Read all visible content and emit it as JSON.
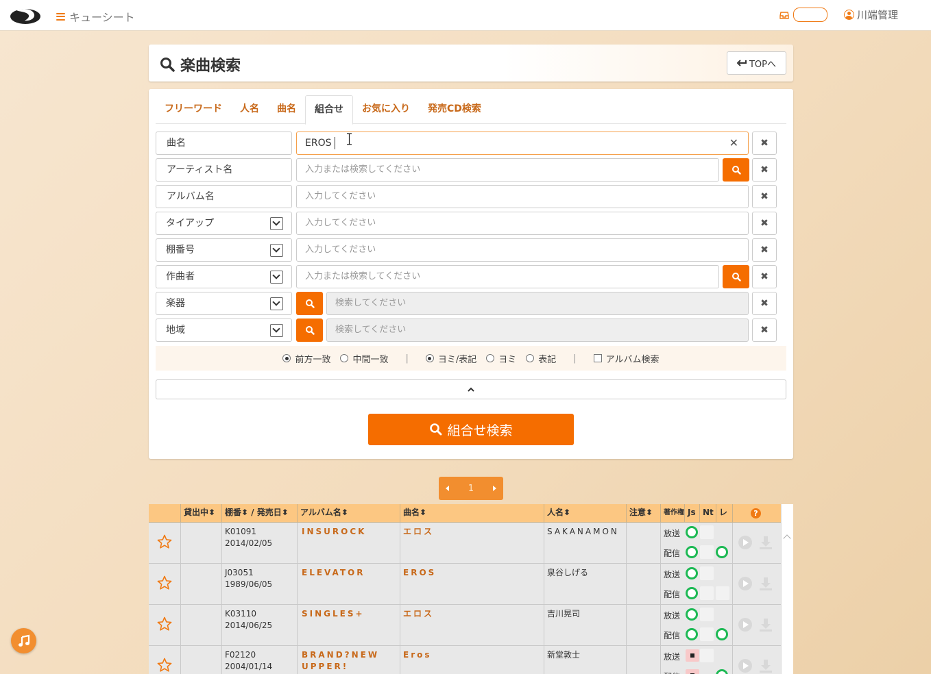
{
  "app": {
    "title": "キューシート",
    "user": "川端管理"
  },
  "header": {
    "title": "楽曲検索",
    "top_button": "TOPへ"
  },
  "tabs": [
    {
      "label": "フリーワード",
      "active": false
    },
    {
      "label": "人名",
      "active": false
    },
    {
      "label": "曲名",
      "active": false
    },
    {
      "label": "組合せ",
      "active": true
    },
    {
      "label": "お気に入り",
      "active": false
    },
    {
      "label": "発売CD検索",
      "active": false
    }
  ],
  "fields": [
    {
      "label": "曲名",
      "value": "EROS",
      "placeholder": ""
    },
    {
      "label": "アーティスト名",
      "value": "",
      "placeholder": "入力または検索してください"
    },
    {
      "label": "アルバム名",
      "value": "",
      "placeholder": "入力してください"
    },
    {
      "label": "タイアップ",
      "value": "",
      "placeholder": "入力してください"
    },
    {
      "label": "棚番号",
      "value": "",
      "placeholder": "入力してください"
    },
    {
      "label": "作曲者",
      "value": "",
      "placeholder": "入力または検索してください"
    },
    {
      "label": "楽器",
      "value": "",
      "placeholder": "検索してください"
    },
    {
      "label": "地域",
      "value": "",
      "placeholder": "検索してください"
    }
  ],
  "options": {
    "match": [
      {
        "label": "前方一致",
        "selected": true
      },
      {
        "label": "中間一致",
        "selected": false
      }
    ],
    "reading": [
      {
        "label": "ヨミ/表記",
        "selected": true
      },
      {
        "label": "ヨミ",
        "selected": false
      },
      {
        "label": "表記",
        "selected": false
      }
    ],
    "album_search": {
      "label": "アルバム検索",
      "checked": false
    }
  },
  "submit_label": "組合せ検索",
  "pagination": {
    "current": "1"
  },
  "table": {
    "headers": {
      "lending": "貸出中⬍",
      "shelf": "棚番⬍ / 発売日⬍",
      "album": "アルバム名⬍",
      "song": "曲名⬍",
      "person": "人名⬍",
      "note": "注意⬍",
      "copyright": "著作権",
      "js": "Js",
      "nt": "Nt",
      "re": "レ",
      "help": "?"
    },
    "broadcast_label": "放送",
    "delivery_label": "配信",
    "rows": [
      {
        "shelf": "K01091",
        "date": "2014/02/05",
        "album": "INSUROCK",
        "song": "エロス",
        "person": "SAKANAMON"
      },
      {
        "shelf": "J03051",
        "date": "1989/06/05",
        "album": "ELEVATOR",
        "song": "EROS",
        "person": "泉谷しげる"
      },
      {
        "shelf": "K03110",
        "date": "2014/06/25",
        "album": "SINGLES+",
        "song": "エロス",
        "person": "吉川晃司"
      },
      {
        "shelf": "F02120",
        "date": "2004/01/14",
        "album": "BRAND?NEW UPPER!",
        "song": "Eros",
        "person": "新堂敦士"
      }
    ]
  },
  "colors": {
    "accent": "#f56d00",
    "tab_text": "#c8691a",
    "table_header": "#fcc782",
    "status_ok": "#1db954"
  }
}
